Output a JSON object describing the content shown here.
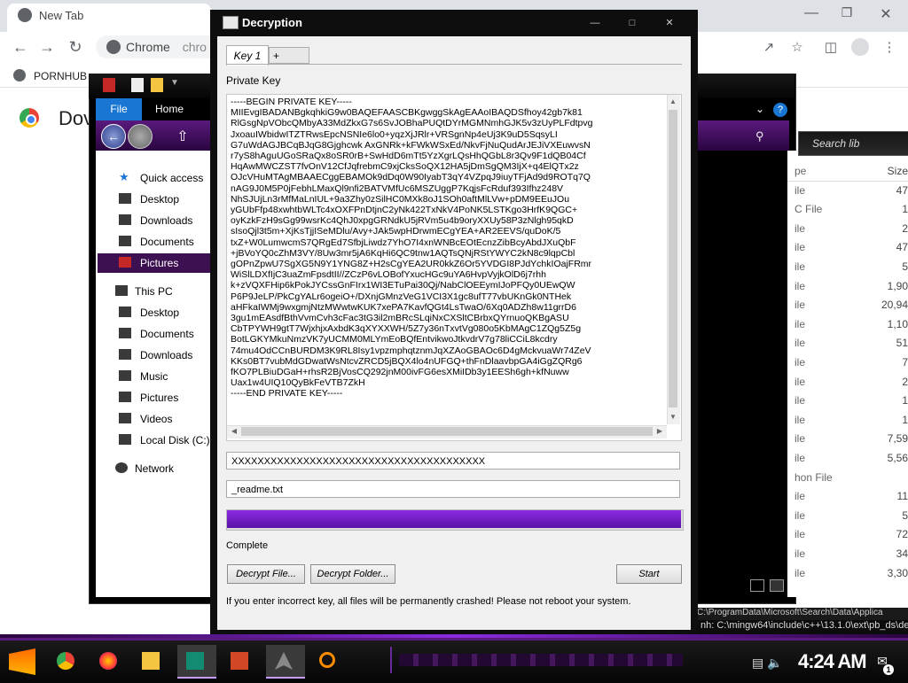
{
  "chrome": {
    "tab_title": "New Tab",
    "omnibox_text": "Chrome",
    "omnibox_text_2": "chro",
    "bookmark": "PORNHUB",
    "page_title": "Dov"
  },
  "explorer": {
    "ribbon_file": "File",
    "ribbon_home": "Home",
    "search_placeholder": "Search lib",
    "size_header": "Size",
    "nav": {
      "quick_access": "Quick access",
      "desktop": "Desktop",
      "downloads": "Downloads",
      "documents": "Documents",
      "pictures": "Pictures",
      "this_pc": "This PC",
      "pc_desktop": "Desktop",
      "pc_documents": "Documents",
      "pc_downloads": "Downloads",
      "music": "Music",
      "pc_pictures": "Pictures",
      "videos": "Videos",
      "local_disk": "Local Disk (C:)",
      "network": "Network"
    },
    "file_rows": [
      {
        "type": "pe",
        "size": "Size"
      },
      {
        "type": "ile",
        "size": "47"
      },
      {
        "type": "C File",
        "size": "1"
      },
      {
        "type": "ile",
        "size": "2"
      },
      {
        "type": "ile",
        "size": "47"
      },
      {
        "type": "ile",
        "size": "5"
      },
      {
        "type": "ile",
        "size": "1,90"
      },
      {
        "type": "ile",
        "size": "20,94"
      },
      {
        "type": "ile",
        "size": "1,10"
      },
      {
        "type": "ile",
        "size": "51"
      },
      {
        "type": "ile",
        "size": "7"
      },
      {
        "type": "ile",
        "size": "2"
      },
      {
        "type": "ile",
        "size": "1"
      },
      {
        "type": "ile",
        "size": "1"
      },
      {
        "type": "ile",
        "size": "7,59"
      },
      {
        "type": "ile",
        "size": "5,56"
      },
      {
        "type": "hon File",
        "size": ""
      },
      {
        "type": "ile",
        "size": "11"
      },
      {
        "type": "ile",
        "size": "5"
      },
      {
        "type": "ile",
        "size": "72"
      },
      {
        "type": "ile",
        "size": "34"
      },
      {
        "type": "ile",
        "size": "3,30"
      }
    ]
  },
  "console": {
    "top_line": "C:\\ProgramData\\Microsoft\\Search\\Data\\Applica",
    "path": "nh: C:\\mingw64\\include\\c++\\13.1.0\\ext\\pb_ds\\de"
  },
  "decryption": {
    "title": "Decryption",
    "tab_key1": "Key 1",
    "tab_add": "+",
    "private_key_label": "Private Key",
    "private_key_text": "-----BEGIN PRIVATE KEY-----\nMIIEvgIBADANBgkqhkiG9w0BAQEFAASCBKgwggSkAgEAAoIBAQDSfhoy42gb7k81\nRlGsgNpVObcQMbyA33MdZkxG7s6SvJOBhaPUQtDYrMGMNmhGJK5v3zUyPLFdtpvg\nJxoauIWbidwITZTRwsEpcNSNIe6lo0+yqzXjJRlr+VRSgnNp4eUj3K9uD5SqsyLI\nG7uWdAGJBCqBJqG8Gjghcwk AxGNRk+kFWkWSxEd/NkvFjNuQudArJEJiVXEuwvsN\nr7yS8hAguUGoSRaQx8oSR0rB+SwHdD6mTt5YzXgrLQsHhQGbL8r3Qv9F1dQB04Cf\nHqAwMWCZST7fvOnV12CfJqfrebmC9xjCksSoQX12HA5jDmSgQM3IjX+q4ElQTx2z\nOJcVHuMTAgMBAAECggEBAMOk9dDq0W90IyabT3qY4VZpqJ9iuyTFjAd9d9ROTq7Q\nnAG9J0M5P0jFebhLMaxQl9nfi2BATVMfUc6MSZUggP7KqjsFcRduf393Ifhz248V\nNhSJUjLn3rMfMaLnIUL+9a3Zhy0zSilHC0MXk8oJ1SOh0aftMlLVw+pDM9EEuJOu\nyGUbFfp48xwhtbWLTc4xOXFPnDtjnC2yNk422TxNkV4PoNK5LSTKgo3HrfK9QGC+\noyKzkFzH9sGg99wsrKc4QhJ0xpgGRNdkU5jRVm5u4b9oryXXUy58P3zNlgh95qkD\nsIsoQjl3t5m+XjKsTjjISeMDlu/Avy+JAk5wpHDrwmECgYEA+AR2EEVS/quDoK/5\ntxZ+W0LumwcmS7QRgEd7SfbjLiwdz7YhO7I4xnWNBcEOtEcnzZibBcyAbdJXuQbF\n+jBVoYQ0cZhM3VY/8Uw3mr5jA6KqHi6QC9tnw1AQTsQNjRStYWYC2kN8c9lqpCbl\ngOPnZpwU7SgXG5N9Y1YNG8Z+H2sCgYEA2UR0kkZ6Or5YVDGI8PJdYchkIOajFRmr\nWiSlLDXfIjC3uaZmFpsdtII//ZCzP6vLOBofYxucHGc9uYA6HvpVyjkOlD6j7rhh\nk+zVQXFHip6kPokJYCssGnFIrx1WI3ETuPai30Qj/NabClOEEymIJoPFQy0UEwQW\nP6P9JeLP/PkCgYALr6ogeiO+/DXnjGMnzVeG1VCI3X1gc8ufT77vbUKnGk0NTHek\naHFkaIWMj9wxgmjNtzMWwtwKUK7xePA7KavfQGt4LsTwaO/6Xq0ADZh8w11grrD6\n3gu1mEAsdfBthVvmCvh3cFac3tG3il2mBRcSLqiNxCXSltCBrbxQYrnuoQKBgASU\nCbTPYWH9gtT7WjxhjxAxbdK3qXYXXWH/5Z7y36nTxvtVg080o5KbMAgC1ZQg5Z5g\nBotLGKYMkuNmzVK7yUCMM0MLYmEoBQfEntvikwoJtkvdrV7g78liCCiL8kcdry\n74mu4OdCCnBURDM3K9RL8Isy1vpzmphqtznmJqXZAoGBAOc6D4gMckvuaWr74ZeV\nKKs0BT7vubMdGDwatWsNtcvZRCD5jBQX4lo4nUFGQ+thFnDlaavbpGA4iGgZQRg6\nfKO7PLBiuDGaH+rhsR2BjVosCQ292jnM00ivFG6esXMiIDb3y1EESh6gh+kfNuww\nUax1w4UIQ10QyBkFeVTB7ZkH\n-----END PRIVATE KEY-----",
    "key_field": "XXXXXXXXXXXXXXXXXXXXXXXXXXXXXXXXXXXXXXX",
    "readme_field": "_readme.txt",
    "progress_percent": 100,
    "status": "Complete",
    "decrypt_file_btn": "Decrypt File...",
    "decrypt_folder_btn": "Decrypt Folder...",
    "start_btn": "Start",
    "warning": "If you enter incorrect key, all files will be permanently crashed! Please not reboot your system."
  },
  "taskbar": {
    "clock": "4:24 AM",
    "notification_count": "1",
    "apps": [
      "start-icon",
      "chrome-icon",
      "firefox-icon",
      "file-explorer-icon",
      "publisher-icon",
      "powerpoint-icon",
      "jet-icon",
      "search-magnifier-icon"
    ]
  },
  "colors": {
    "accent_purple": "#5a1a7d",
    "progress_purple": "#7a1fd4",
    "file_tab_blue": "#1976d2"
  }
}
